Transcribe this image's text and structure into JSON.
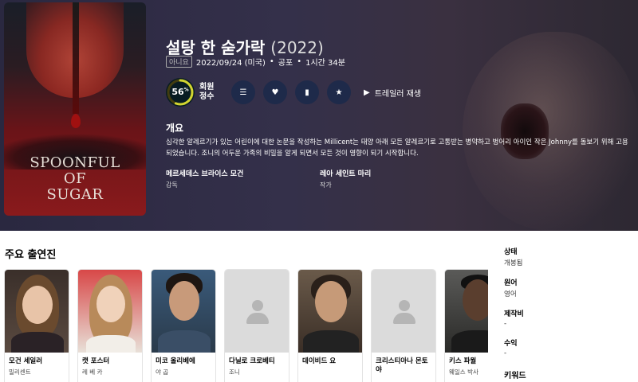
{
  "movie": {
    "title": "설탕 한 숟가락",
    "year": "(2022)",
    "certification": "아니요",
    "release": "2022/09/24 (미국)",
    "genre": "공포",
    "runtime": "1시간 34분",
    "poster_title": "SPOONFUL\nOF\nSUGAR"
  },
  "score": {
    "value": 56,
    "display": "56",
    "unit": "%",
    "label": "회원 정수",
    "color": "#d2d531",
    "track": "#423d0f"
  },
  "actions": {
    "list_icon": "list-icon",
    "favorite_icon": "heart-icon",
    "watchlist_icon": "bookmark-icon",
    "rate_icon": "star-icon",
    "trailer_label": "트레일러 재생"
  },
  "overview": {
    "heading": "개요",
    "text": "심각한 알레르기가 있는 어린이에 대한 논문을 작성하는 Millicent는 태양 아래 모든 알레르기로 고통받는 병약하고 벙어리 아이인 작은 Johnny를 돌보기 위해 고용되었습니다. 조니의 어두운 가족의 비밀을 알게 되면서 모든 것이 영향이 되기 시작합니다."
  },
  "crew": [
    {
      "name": "메르세데스 브라이스 모건",
      "role": "감독"
    },
    {
      "name": "레아 세인트 마리",
      "role": "작가"
    }
  ],
  "cast": {
    "heading": "주요 출연진",
    "members": [
      {
        "name": "모건 세일러",
        "character": "밀리센트"
      },
      {
        "name": "캣 포스터",
        "character": "레 베 카"
      },
      {
        "name": "미코 올리베에",
        "character": "야 곱"
      },
      {
        "name": "다닐로 크로베티",
        "character": "조니"
      },
      {
        "name": "데이비드 요",
        "character": ""
      },
      {
        "name": "크리스티아나 몬토야",
        "character": ""
      },
      {
        "name": "키스 파월",
        "character": "웨일스 박사"
      }
    ]
  },
  "facts": [
    {
      "label": "상태",
      "value": "개봉됨"
    },
    {
      "label": "원어",
      "value": "영어"
    },
    {
      "label": "제작비",
      "value": "-"
    },
    {
      "label": "수익",
      "value": "-"
    }
  ],
  "keywords_heading": "키워드"
}
